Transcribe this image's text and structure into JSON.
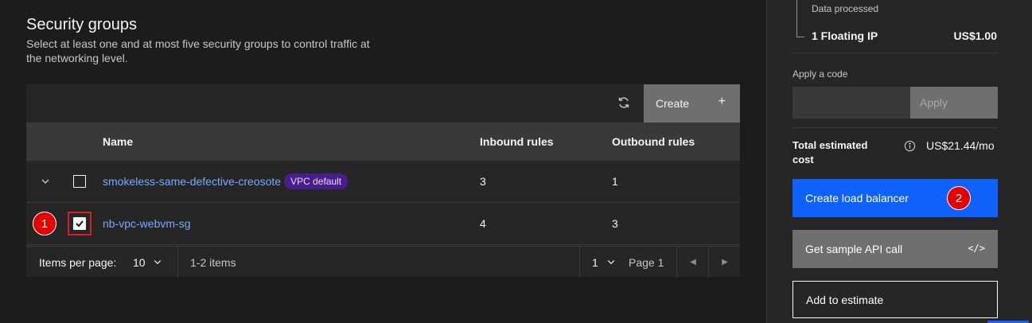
{
  "main": {
    "title": "Security groups",
    "description": "Select at least one and at most five security groups to control traffic at the networking level."
  },
  "table": {
    "create_label": "Create",
    "columns": {
      "name": "Name",
      "inbound": "Inbound rules",
      "outbound": "Outbound rules"
    },
    "rows": [
      {
        "name": "smokeless-same-defective-creosote",
        "tag": "VPC default",
        "inbound": "3",
        "outbound": "1",
        "checked": false
      },
      {
        "name": "nb-vpc-webvm-sg",
        "inbound": "4",
        "outbound": "3",
        "checked": true
      }
    ],
    "pagination": {
      "items_per_page_label": "Items per page:",
      "items_per_page": "10",
      "range": "1-2 items",
      "page": "1",
      "page_label": "Page 1"
    }
  },
  "markers": {
    "one": "1",
    "two": "2"
  },
  "summary": {
    "data_processed": "Data processed",
    "floating_ip": "1 Floating IP",
    "floating_ip_price": "US$1.00",
    "apply_code_label": "Apply a code",
    "apply_code_value": "",
    "apply_button": "Apply",
    "total_label": "Total estimated cost",
    "total_value": "US$21.44/mo",
    "create_button": "Create load balancer",
    "sample_api_button": "Get sample API call",
    "add_estimate_button": "Add to estimate"
  },
  "colors": {
    "primary": "#0f62fe",
    "link": "#78a9ff",
    "tag_bg": "#491d8b",
    "highlight": "#da1e28"
  },
  "icons": [
    "refresh-icon",
    "plus-icon",
    "chevron-down-icon",
    "checkbox-icon",
    "info-icon",
    "code-icon",
    "caret-left-icon",
    "caret-right-icon"
  ]
}
